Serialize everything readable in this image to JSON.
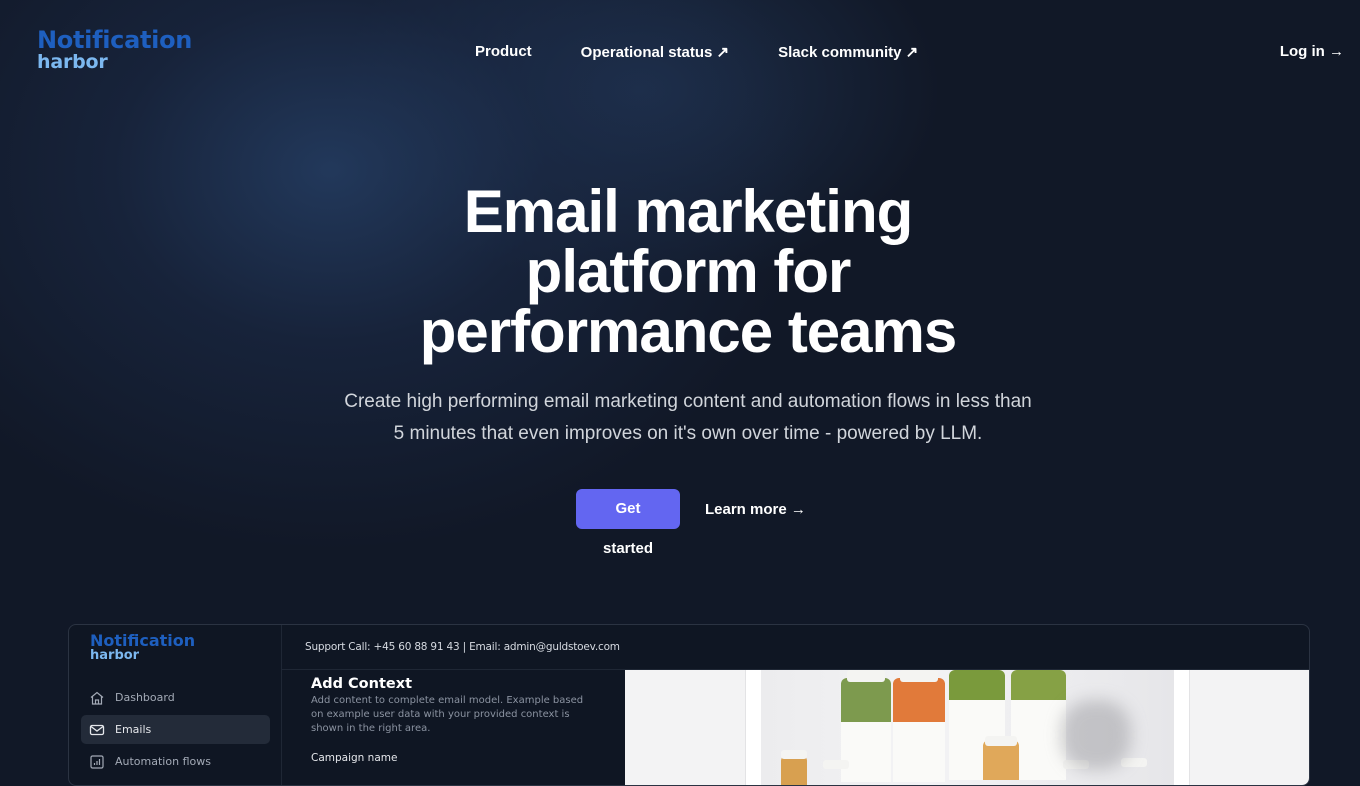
{
  "brand": {
    "line1": "Notification",
    "line2": "harbor"
  },
  "nav": {
    "items": [
      {
        "label": "Product"
      },
      {
        "label": "Operational status ↗"
      },
      {
        "label": "Slack community ↗"
      }
    ],
    "login": "Log in →"
  },
  "hero": {
    "title_lines": [
      "Email marketing",
      "platform for",
      "performance teams"
    ],
    "subtitle": "Create high performing email marketing content and automation flows in less than 5 minutes that even improves on it's own over time - powered by LLM.",
    "primary_cta": "Get started",
    "secondary_cta": "Learn more →"
  },
  "preview": {
    "brand": {
      "line1": "Notification",
      "line2": "harbor"
    },
    "sidebar": [
      {
        "label": "Dashboard",
        "icon": "home-icon",
        "active": false
      },
      {
        "label": "Emails",
        "icon": "mail-icon",
        "active": true
      },
      {
        "label": "Automation flows",
        "icon": "chart-icon",
        "active": false
      }
    ],
    "support": "Support Call: +45 60 88 91 43 | Email: admin@guldstoev.com",
    "form": {
      "heading": "Add Context",
      "description": "Add content to complete email model. Example based on example user data with your provided context is shown in the right area.",
      "field_label": "Campaign name"
    }
  },
  "colors": {
    "background": "#111827",
    "accent": "#6366f1",
    "brand_dark_blue": "#1e5fbf",
    "brand_light_blue": "#7cb8f0"
  }
}
